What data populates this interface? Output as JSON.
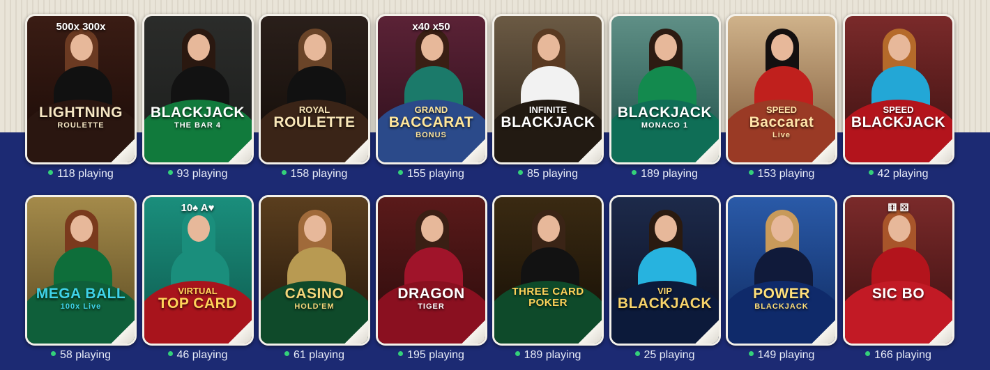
{
  "games": [
    {
      "pre": "",
      "title": "LIGHTNING",
      "sub": "ROULETTE",
      "extra": "500x   300x",
      "players": "118 playing",
      "bg": [
        "#3a1c14",
        "#1a0b07"
      ],
      "felt": "#2a1610",
      "hair": "#6b3a22",
      "outfit": "#111111",
      "text": "#f6e7c4"
    },
    {
      "pre": "",
      "title": "BLACKJACK",
      "sub": "THE BAR 4",
      "extra": "",
      "players": "93 playing",
      "bg": [
        "#2b2c2a",
        "#1b1d1c"
      ],
      "felt": "#117a3c",
      "hair": "#2a1810",
      "outfit": "#121212",
      "text": "#ffffff"
    },
    {
      "pre": "ROYAL",
      "title": "ROULETTE",
      "sub": "",
      "extra": "",
      "players": "158 playing",
      "bg": [
        "#2a1f1a",
        "#120c08"
      ],
      "felt": "#3a2417",
      "hair": "#6a4428",
      "outfit": "#111111",
      "text": "#f8e6b8"
    },
    {
      "pre": "GRAND",
      "title": "BACCARAT",
      "sub": "BONUS",
      "extra": "x40   x50",
      "players": "155 playing",
      "bg": [
        "#5b2236",
        "#2c0f1b"
      ],
      "felt": "#2b4a8a",
      "hair": "#3a1f14",
      "outfit": "#1b7a6a",
      "text": "#ffe69a"
    },
    {
      "pre": "INFINITE",
      "title": "BLACKJACK",
      "sub": "",
      "extra": "",
      "players": "85 playing",
      "bg": [
        "#6b5a44",
        "#2b2218"
      ],
      "felt": "#221a12",
      "hair": "#5a3a22",
      "outfit": "#f2f2f2",
      "text": "#ffffff"
    },
    {
      "pre": "",
      "title": "BLACKJACK",
      "sub": "MONACO 1",
      "extra": "",
      "players": "189 playing",
      "bg": [
        "#5f8f86",
        "#1f4f48"
      ],
      "felt": "#0f6e56",
      "hair": "#2d1b12",
      "outfit": "#138a4e",
      "text": "#ffffff"
    },
    {
      "pre": "SPEED",
      "title": "Baccarat",
      "sub": "Live",
      "extra": "",
      "players": "153 playing",
      "bg": [
        "#cfb28a",
        "#7a5535"
      ],
      "felt": "#9a3a25",
      "hair": "#141010",
      "outfit": "#c0201d",
      "text": "#ffe3a8"
    },
    {
      "pre": "SPEED",
      "title": "BLACKJACK",
      "sub": "",
      "extra": "",
      "players": "42 playing",
      "bg": [
        "#7a2a2a",
        "#3b1010"
      ],
      "felt": "#b3141c",
      "hair": "#b56a2a",
      "outfit": "#23a7d6",
      "text": "#ffffff"
    },
    {
      "pre": "",
      "title": "MEGA BALL",
      "sub": "100x  Live",
      "extra": "",
      "players": "58 playing",
      "bg": [
        "#a48a4a",
        "#5a4a22"
      ],
      "felt": "#0f5f3a",
      "hair": "#7a3a1d",
      "outfit": "#0e6e3a",
      "text": "#3fd2e8"
    },
    {
      "pre": "VIRTUAL",
      "title": "TOP CARD",
      "sub": "",
      "extra": "10♠   A♥",
      "players": "46 playing",
      "bg": [
        "#1a8e7c",
        "#0e5a4e"
      ],
      "felt": "#a8141c",
      "hair": "#1a8e7c",
      "outfit": "#1a8e7c",
      "text": "#ffd35a"
    },
    {
      "pre": "",
      "title": "CASINO",
      "sub": "HOLD'EM",
      "extra": "",
      "players": "61 playing",
      "bg": [
        "#5a3e1e",
        "#24160a"
      ],
      "felt": "#0f4a2a",
      "hair": "#a06a3a",
      "outfit": "#b89a52",
      "text": "#f3d57a"
    },
    {
      "pre": "",
      "title": "DRAGON",
      "sub": "TIGER",
      "extra": "",
      "players": "195 playing",
      "bg": [
        "#5a1a1a",
        "#2a0b0b"
      ],
      "felt": "#8a1020",
      "hair": "#3a1f14",
      "outfit": "#a0142a",
      "text": "#ffffff"
    },
    {
      "pre": "",
      "title": "THREE CARD POKER",
      "sub": "",
      "extra": "",
      "players": "189 playing",
      "bg": [
        "#3a2a12",
        "#140d05"
      ],
      "felt": "#0e4a2a",
      "hair": "#3a2416",
      "outfit": "#121212",
      "text": "#ffd35a"
    },
    {
      "pre": "VIP",
      "title": "BLACKJACK",
      "sub": "",
      "extra": "",
      "players": "25 playing",
      "bg": [
        "#1d2a4a",
        "#0a0f22"
      ],
      "felt": "#0c1a3a",
      "hair": "#2a1a10",
      "outfit": "#27b3df",
      "text": "#f7d36a"
    },
    {
      "pre": "",
      "title": "POWER",
      "sub": "BLACKJACK",
      "extra": "",
      "players": "149 playing",
      "bg": [
        "#2a5aa8",
        "#0f2a60"
      ],
      "felt": "#0f2a6a",
      "hair": "#c89a5a",
      "outfit": "#101a3a",
      "text": "#ffe07a"
    },
    {
      "pre": "",
      "title": "SIC BO",
      "sub": "",
      "extra": "⚅ ⚄",
      "players": "166 playing",
      "bg": [
        "#7a2a2a",
        "#3a0f10"
      ],
      "felt": "#c21a25",
      "hair": "#a8552a",
      "outfit": "#b3141c",
      "text": "#ffffff"
    }
  ]
}
